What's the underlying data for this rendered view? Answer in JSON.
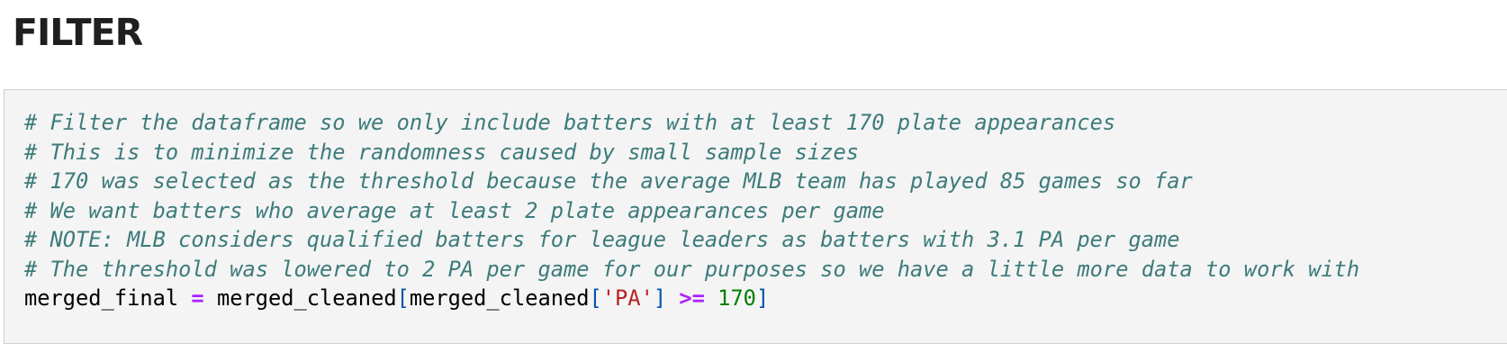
{
  "heading": "FILTER",
  "code": {
    "comments": [
      "# Filter the dataframe so we only include batters with at least 170 plate appearances",
      "# This is to minimize the randomness caused by small sample sizes",
      "# 170 was selected as the threshold because the average MLB team has played 85 games so far",
      "# We want batters who average at least 2 plate appearances per game",
      "# NOTE: MLB considers qualified batters for league leaders as batters with 3.1 PA per game",
      "# The threshold was lowered to 2 PA per game for our purposes so we have a little more data to work with"
    ],
    "statement": {
      "target": "merged_final",
      "assign_op": "=",
      "source": "merged_cleaned",
      "open_bracket": "[",
      "inner_source": "merged_cleaned",
      "inner_open": "[",
      "column": "'PA'",
      "inner_close": "]",
      "compare_op": ">=",
      "threshold": "170",
      "close_bracket": "]"
    }
  }
}
